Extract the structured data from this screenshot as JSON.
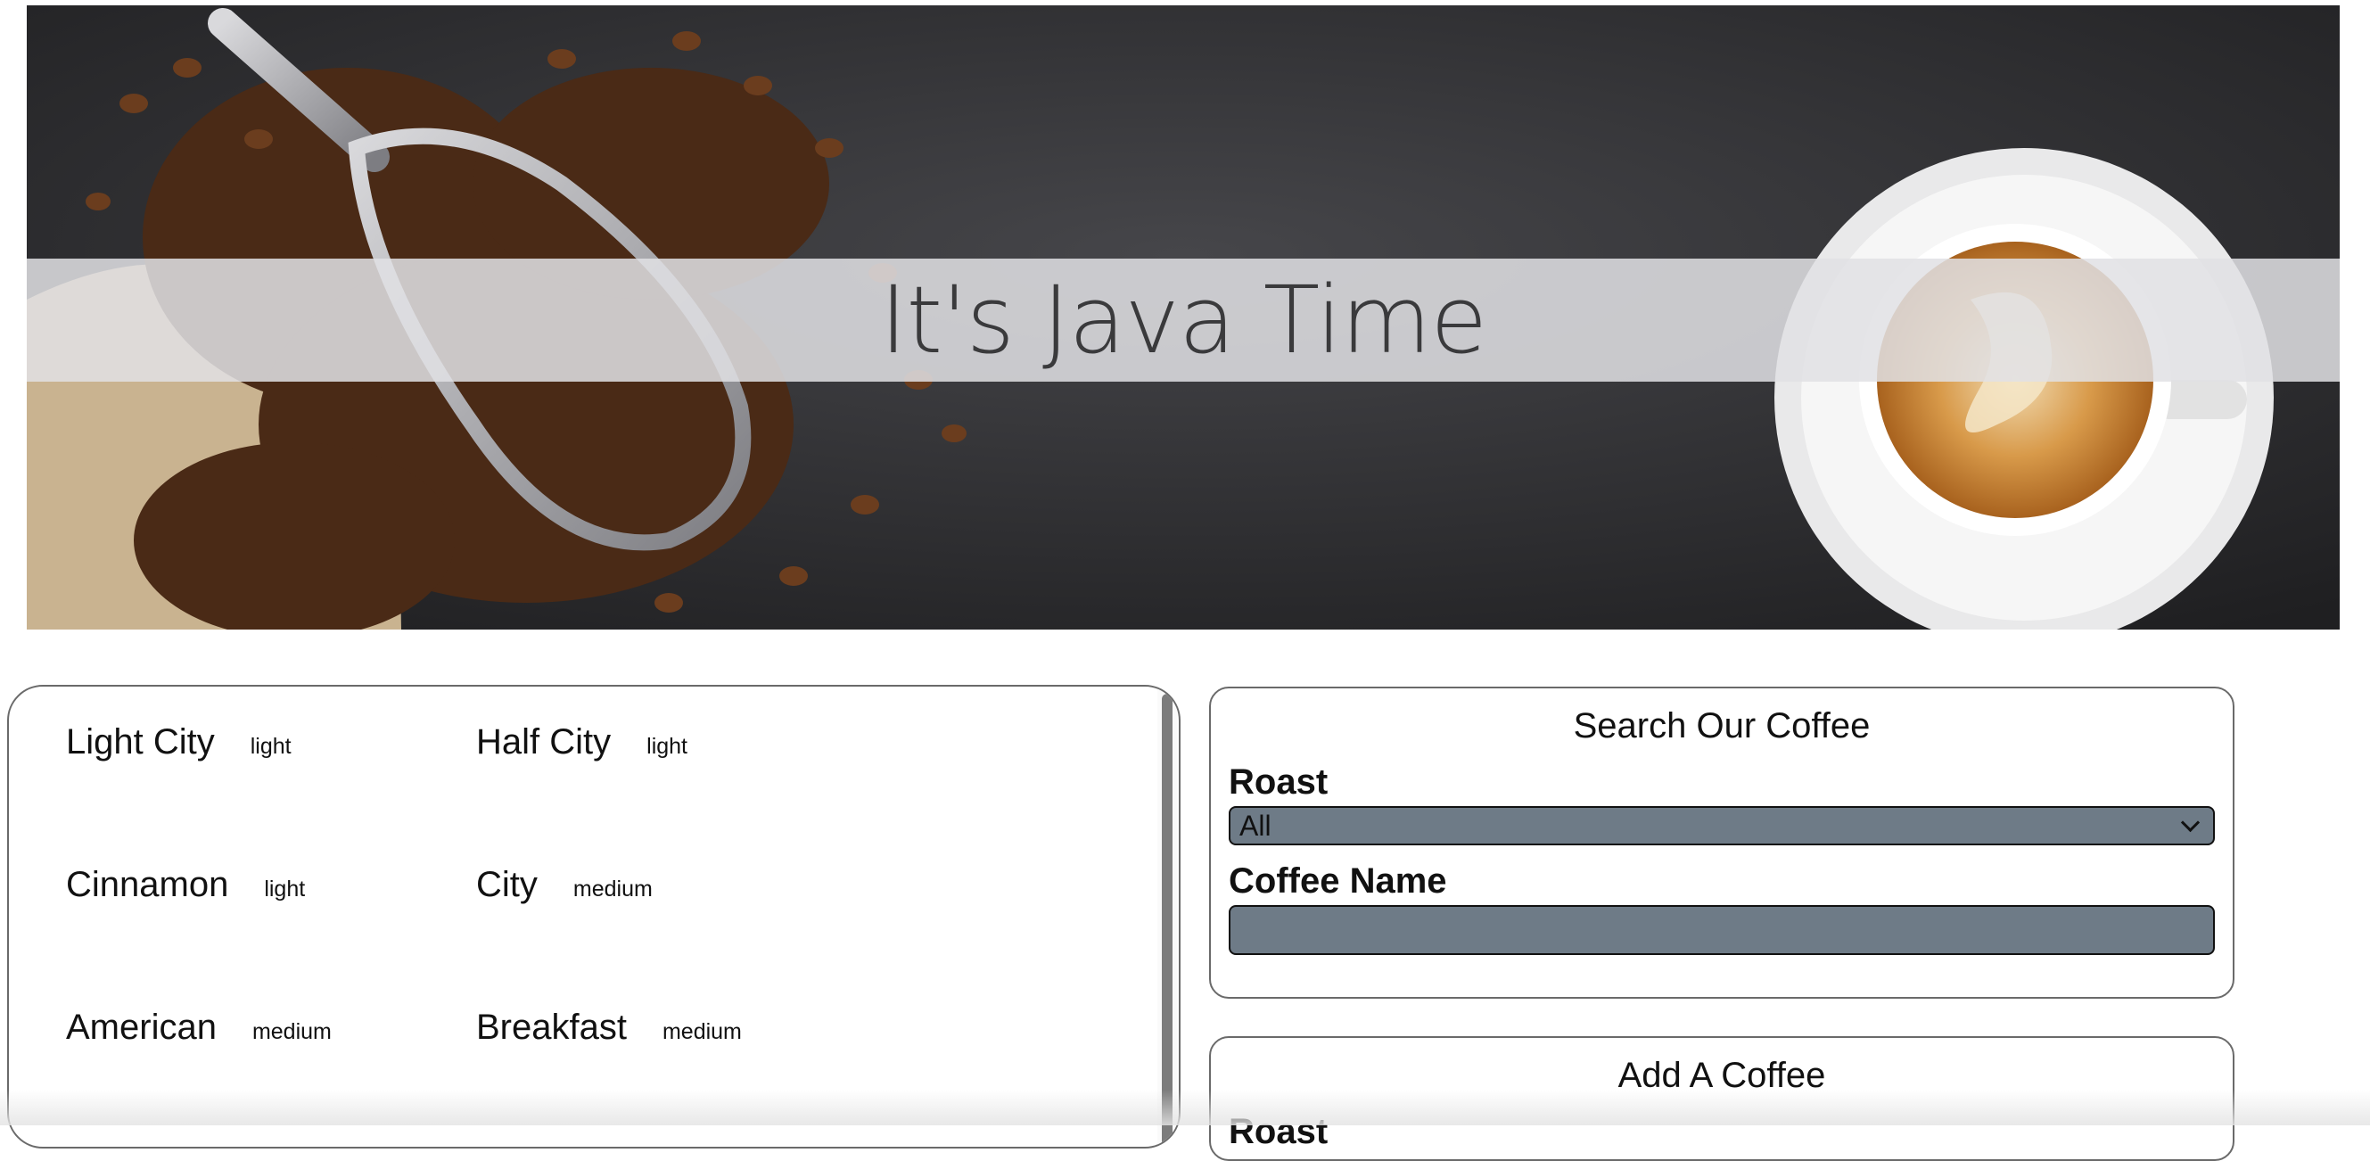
{
  "header": {
    "title": "It's Java Time",
    "banner_icon": "coffee-banner-image"
  },
  "coffees": [
    {
      "name": "Light City",
      "roast": "light"
    },
    {
      "name": "Half City",
      "roast": "light"
    },
    {
      "name": "Cinnamon",
      "roast": "light"
    },
    {
      "name": "City",
      "roast": "medium"
    },
    {
      "name": "American",
      "roast": "medium"
    },
    {
      "name": "Breakfast",
      "roast": "medium"
    }
  ],
  "search": {
    "heading": "Search Our Coffee",
    "roast_label": "Roast",
    "roast_value": "All",
    "name_label": "Coffee Name",
    "name_value": ""
  },
  "add": {
    "heading": "Add A Coffee",
    "roast_label": "Roast"
  },
  "colors": {
    "field_bg": "#6e7b87",
    "banner_bg": "#2a2a2c",
    "title_strip": "#e1e1e4"
  }
}
